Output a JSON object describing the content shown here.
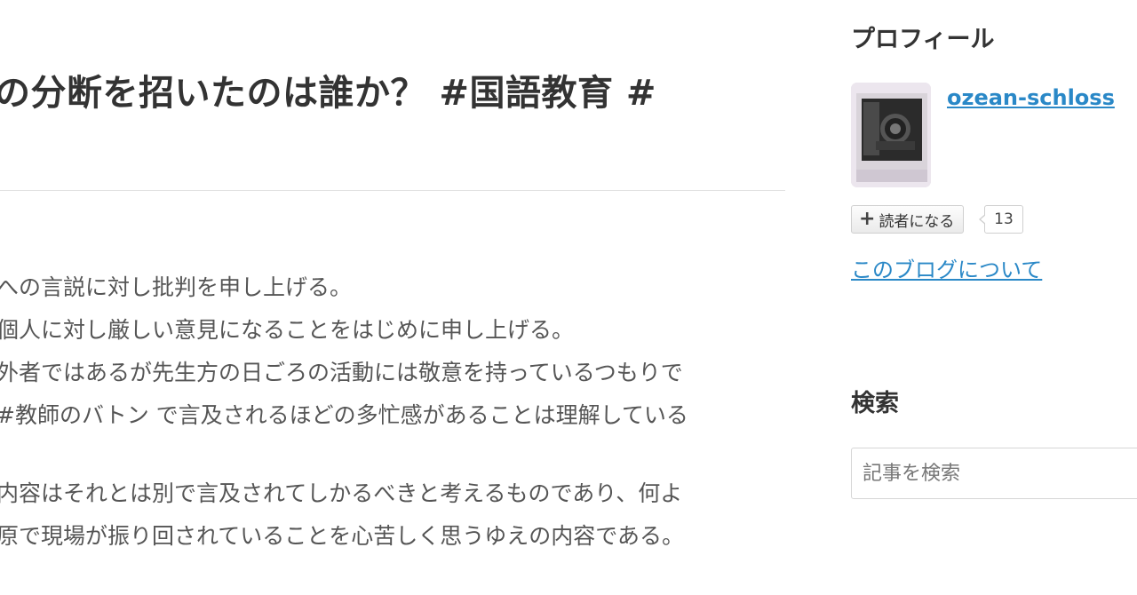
{
  "article": {
    "title": "の分断を招いたのは誰か？ #国語教育 #",
    "paragraphs": [
      [
        "への言説に対し批判を申し上げる。",
        "個人に対し厳しい意見になることをはじめに申し上げる。",
        "外者ではあるが先生方の日ごろの活動には敬意を持っているつもりで",
        "#教師のバトン で言及されるほどの多忙感があることは理解している"
      ],
      [
        "内容はそれとは別で言及されてしかるべきと考えるものであり、何よ",
        "原で現場が振り回されていることを心苦しく思うゆえの内容である。"
      ]
    ]
  },
  "sidebar": {
    "profile": {
      "heading": "プロフィール",
      "username": "ozean-schloss",
      "subscribe_label": "読者になる",
      "subscriber_count": "13",
      "about_link": "このブログについて"
    },
    "search": {
      "heading": "検索",
      "placeholder": "記事を検索"
    }
  },
  "colors": {
    "link": "#2a88c7",
    "text": "#333333",
    "body_text": "#555555"
  }
}
